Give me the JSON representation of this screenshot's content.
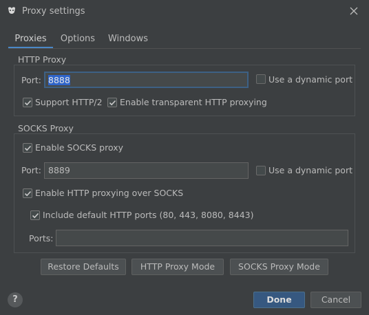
{
  "window": {
    "title": "Proxy settings"
  },
  "tabs": [
    {
      "label": "Proxies"
    },
    {
      "label": "Options"
    },
    {
      "label": "Windows"
    }
  ],
  "http_proxy": {
    "title": "HTTP Proxy",
    "port_label": "Port:",
    "port_value": "8888",
    "dynamic_port_label": "Use a dynamic port",
    "dynamic_port_checked": false,
    "support_http2_label": "Support HTTP/2",
    "support_http2_checked": true,
    "transparent_label": "Enable transparent HTTP proxying",
    "transparent_checked": true
  },
  "socks_proxy": {
    "title": "SOCKS Proxy",
    "enable_label": "Enable SOCKS proxy",
    "enable_checked": true,
    "port_label": "Port:",
    "port_value": "8889",
    "dynamic_port_label": "Use a dynamic port",
    "dynamic_port_checked": false,
    "http_over_socks_label": "Enable HTTP proxying over SOCKS",
    "http_over_socks_checked": true,
    "include_ports_label": "Include default HTTP ports (80, 443, 8080, 8443)",
    "include_ports_checked": true,
    "ports_label": "Ports:",
    "ports_value": ""
  },
  "buttons": {
    "restore": "Restore Defaults",
    "http_mode": "HTTP Proxy Mode",
    "socks_mode": "SOCKS Proxy Mode",
    "done": "Done",
    "cancel": "Cancel",
    "help": "?"
  },
  "colors": {
    "background": "#3c3f41",
    "accent": "#4a88c7",
    "default_button": "#365880",
    "selection": "#2f65ca"
  },
  "icons": {
    "close": "close-icon",
    "check": "check-icon",
    "help": "help-icon",
    "app": "app-icon"
  }
}
